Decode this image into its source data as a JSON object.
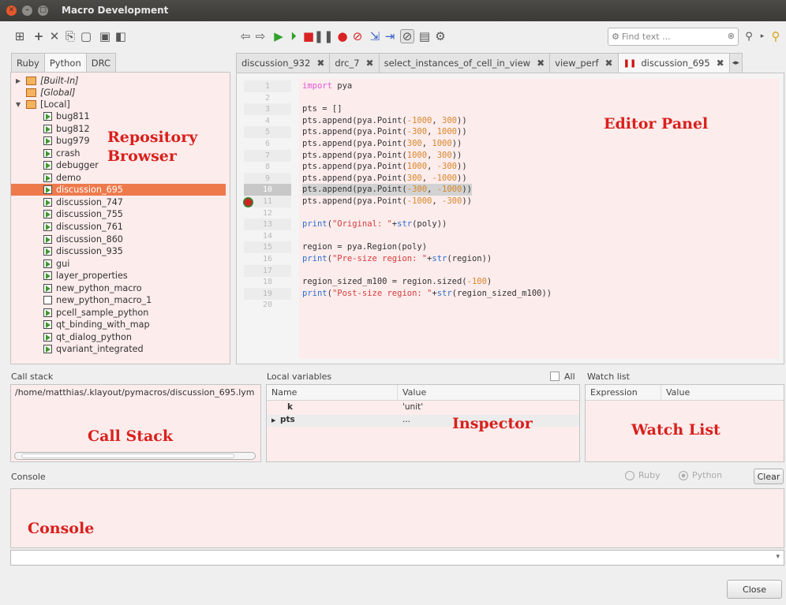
{
  "window": {
    "title": "Macro Development"
  },
  "search": {
    "placeholder": "Find text ..."
  },
  "left_tabs": [
    "Ruby",
    "Python",
    "DRC"
  ],
  "tree": {
    "top": [
      {
        "label": "[Built-In]",
        "italic": true
      },
      {
        "label": "[Global]",
        "italic": true
      },
      {
        "label": "[Local]",
        "italic": false
      }
    ],
    "items": [
      "bug811",
      "bug812",
      "bug979",
      "crash",
      "debugger",
      "demo",
      "discussion_695",
      "discussion_747",
      "discussion_755",
      "discussion_761",
      "discussion_860",
      "discussion_935",
      "gui",
      "layer_properties",
      "new_python_macro",
      "new_python_macro_1",
      "pcell_sample_python",
      "qt_binding_with_map",
      "qt_dialog_python",
      "qvariant_integrated"
    ],
    "selected": "discussion_695"
  },
  "editor_tabs": [
    "discussion_932",
    "drc_7",
    "select_instances_of_cell_in_view",
    "view_perf",
    "discussion_695"
  ],
  "editor": {
    "line_numbers": [
      "1",
      "2",
      "3",
      "4",
      "5",
      "6",
      "7",
      "8",
      "9",
      "10",
      "11",
      "12",
      "13",
      "14",
      "15",
      "16",
      "17",
      "18",
      "19",
      "20"
    ],
    "breakpoint_line": 10,
    "code": [
      "import pya",
      "",
      "pts = []",
      "pts.append(pya.Point(-1000, 300))",
      "pts.append(pya.Point(-300, 1000))",
      "pts.append(pya.Point(300, 1000))",
      "pts.append(pya.Point(1000, 300))",
      "pts.append(pya.Point(1000, -300))",
      "pts.append(pya.Point(300, -1000))",
      "pts.append(pya.Point(-300, -1000))",
      "pts.append(pya.Point(-1000, -300))",
      "",
      "print(\"Original: \"+str(poly))",
      "",
      "region = pya.Region(poly)",
      "print(\"Pre-size region: \"+str(region))",
      "",
      "region_sized_m100 = region.sized(-100)",
      "print(\"Post-size region: \"+str(region_sized_m100))",
      ""
    ]
  },
  "annotations": {
    "repository": [
      "Repository",
      "Browser"
    ],
    "editor": "Editor Panel",
    "callstack": "Call Stack",
    "inspector": "Inspector",
    "watch": "Watch List",
    "console": "Console"
  },
  "callstack": {
    "label": "Call stack",
    "entry": "/home/matthias/.klayout/pymacros/discussion_695.lym"
  },
  "locals": {
    "label": "Local variables",
    "all_label": "All",
    "headers": [
      "Name",
      "Value"
    ],
    "rows": [
      {
        "name": "k",
        "value": "'unit'"
      },
      {
        "name": "pts",
        "value": "..."
      }
    ]
  },
  "watch": {
    "label": "Watch list",
    "headers": [
      "Expression",
      "Value"
    ]
  },
  "console": {
    "label": "Console",
    "ruby": "Ruby",
    "python": "Python",
    "clear": "Clear"
  },
  "close_label": "Close",
  "colors": {
    "selection": "#ee7a4c",
    "panel_tint": "#fcecec",
    "annotation": "#d9201c"
  }
}
